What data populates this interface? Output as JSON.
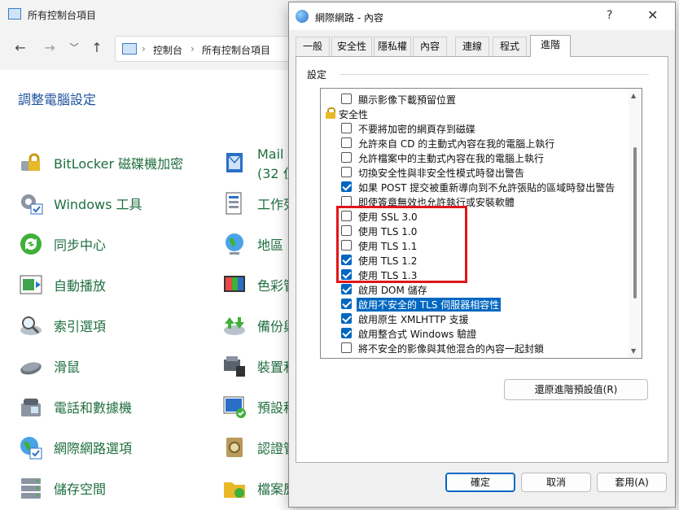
{
  "control_panel": {
    "window_title": "所有控制台項目",
    "breadcrumb": [
      "控制台",
      "所有控制台項目"
    ],
    "heading": "調整電腦設定",
    "items_left": [
      {
        "label": "BitLocker 磁碟機加密",
        "icon": "bitlocker-icon"
      },
      {
        "label": "Windows 工具",
        "icon": "windows-tools-icon"
      },
      {
        "label": "同步中心",
        "icon": "sync-center-icon"
      },
      {
        "label": "自動播放",
        "icon": "autoplay-icon"
      },
      {
        "label": "索引選項",
        "icon": "indexing-icon"
      },
      {
        "label": "滑鼠",
        "icon": "mouse-icon"
      },
      {
        "label": "電話和數據機",
        "icon": "phone-modem-icon"
      },
      {
        "label": "網際網路選項",
        "icon": "internet-options-icon"
      },
      {
        "label": "儲存空間",
        "icon": "storage-spaces-icon"
      }
    ],
    "items_right": [
      {
        "label": "Mail",
        "icon": "mail-icon"
      },
      {
        "label": "工作列",
        "icon": "taskbar-icon"
      },
      {
        "label": "地區",
        "icon": "region-icon"
      },
      {
        "label": "色彩管",
        "icon": "color-management-icon"
      },
      {
        "label": "備份與",
        "icon": "backup-icon"
      },
      {
        "label": "裝置和",
        "icon": "devices-icon"
      },
      {
        "label": "預設程",
        "icon": "default-programs-icon"
      },
      {
        "label": "認證管",
        "icon": "credential-manager-icon"
      },
      {
        "label": "檔案歷",
        "icon": "file-history-icon"
      }
    ],
    "mail_sub": "(32 位"
  },
  "dialog": {
    "title": "網際網路 - 內容",
    "help_glyph": "?",
    "close_glyph": "✕",
    "tabs": [
      "一般",
      "安全性",
      "隱私權",
      "內容",
      "連線",
      "程式",
      "進階"
    ],
    "active_tab": "進階",
    "group_label": "設定",
    "rows": [
      {
        "type": "item",
        "label": "顯示影像下載預留位置",
        "checked": false
      },
      {
        "type": "category",
        "label": "安全性"
      },
      {
        "type": "item",
        "label": "不要將加密的網頁存到磁碟",
        "checked": false
      },
      {
        "type": "item",
        "label": "允許來自 CD 的主動式內容在我的電腦上執行",
        "checked": false
      },
      {
        "type": "item",
        "label": "允許檔案中的主動式內容在我的電腦上執行",
        "checked": false
      },
      {
        "type": "item",
        "label": "切換安全性與非安全性模式時發出警告",
        "checked": false
      },
      {
        "type": "item",
        "label": "如果 POST 提交被重新導向到不允許張貼的區域時發出警告",
        "checked": true
      },
      {
        "type": "item",
        "label": "即使簽章無效也允許執行或安裝軟體",
        "checked": false
      },
      {
        "type": "item",
        "label": "使用 SSL 3.0",
        "checked": false
      },
      {
        "type": "item",
        "label": "使用 TLS 1.0",
        "checked": false
      },
      {
        "type": "item",
        "label": "使用 TLS 1.1",
        "checked": false
      },
      {
        "type": "item",
        "label": "使用 TLS 1.2",
        "checked": true
      },
      {
        "type": "item",
        "label": "使用 TLS 1.3",
        "checked": true
      },
      {
        "type": "item",
        "label": "啟用 DOM 儲存",
        "checked": true
      },
      {
        "type": "item",
        "label": "啟用不安全的 TLS 伺服器相容性",
        "checked": true,
        "selected": true
      },
      {
        "type": "item",
        "label": "啟用原生 XMLHTTP 支援",
        "checked": true
      },
      {
        "type": "item",
        "label": "啟用整合式 Windows 驗證",
        "checked": true
      },
      {
        "type": "item",
        "label": "將不安全的影像與其他混合的內容一起封鎖",
        "checked": false
      }
    ],
    "restore_button": "還原進階預設值(R)",
    "ok_button": "確定",
    "cancel_button": "取消",
    "apply_button": "套用(A)"
  },
  "colors": {
    "accent": "#0067c0",
    "highlight_box": "#e0161b",
    "link_green": "#1f6e3f",
    "heading_blue": "#1a4f9e"
  }
}
